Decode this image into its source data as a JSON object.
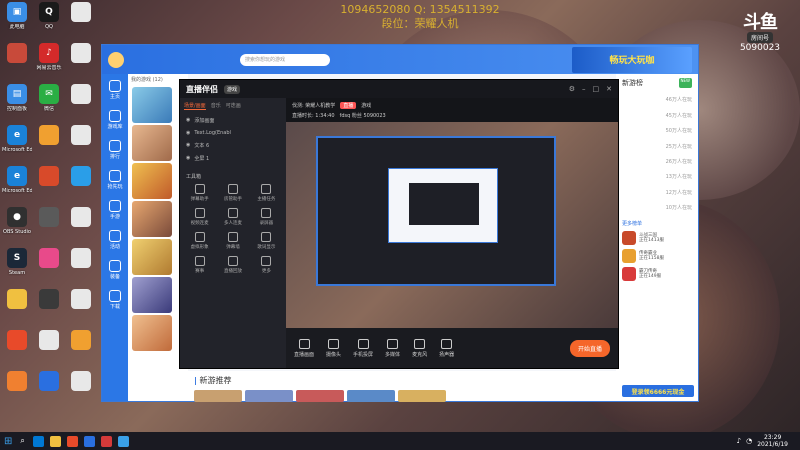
{
  "overlay": {
    "contact_line1": "1094652080  Q:  1354511392",
    "contact_line2": "段位：荣耀人机"
  },
  "room_badge": {
    "logo": "斗鱼",
    "room_label": "房间号",
    "room_id": "5090023"
  },
  "desktop_icons": [
    {
      "label": "此电脑",
      "color": "#3a8ee6",
      "glyph": "▣"
    },
    {
      "label": "QQ",
      "color": "#1a1a1a",
      "glyph": "Q"
    },
    {
      "label": "",
      "color": "#e8e8e8",
      "glyph": ""
    },
    {
      "label": "",
      "color": "#c84a3a",
      "glyph": ""
    },
    {
      "label": "网易云音乐",
      "color": "#d42a2a",
      "glyph": "♪"
    },
    {
      "label": "",
      "color": "#e8e8e8",
      "glyph": ""
    },
    {
      "label": "控制面板",
      "color": "#3a8ee6",
      "glyph": "▤"
    },
    {
      "label": "微信",
      "color": "#2aae44",
      "glyph": "✉"
    },
    {
      "label": "",
      "color": "#e8e8e8",
      "glyph": ""
    },
    {
      "label": "Microsoft Edge",
      "color": "#1a82d8",
      "glyph": "e"
    },
    {
      "label": "",
      "color": "#f0a030",
      "glyph": ""
    },
    {
      "label": "",
      "color": "#e8e8e8",
      "glyph": ""
    },
    {
      "label": "Microsoft Edge",
      "color": "#1a82d8",
      "glyph": "e"
    },
    {
      "label": "",
      "color": "#d84a2a",
      "glyph": ""
    },
    {
      "label": "",
      "color": "#2a9ee8",
      "glyph": ""
    },
    {
      "label": "OBS Studio",
      "color": "#303030",
      "glyph": "●"
    },
    {
      "label": "",
      "color": "#5a5a5a",
      "glyph": ""
    },
    {
      "label": "",
      "color": "#e8e8e8",
      "glyph": ""
    },
    {
      "label": "Steam",
      "color": "#1b2838",
      "glyph": "S"
    },
    {
      "label": "",
      "color": "#e84a8a",
      "glyph": ""
    },
    {
      "label": "",
      "color": "#e8e8e8",
      "glyph": ""
    },
    {
      "label": "",
      "color": "#f0c040",
      "glyph": ""
    },
    {
      "label": "",
      "color": "#3a3a3a",
      "glyph": ""
    },
    {
      "label": "",
      "color": "#e8e8e8",
      "glyph": ""
    },
    {
      "label": "",
      "color": "#e84a2a",
      "glyph": ""
    },
    {
      "label": "",
      "color": "#e8e8e8",
      "glyph": ""
    },
    {
      "label": "",
      "color": "#f0a030",
      "glyph": ""
    },
    {
      "label": "",
      "color": "#f08030",
      "glyph": ""
    },
    {
      "label": "",
      "color": "#2a6fe0",
      "glyph": ""
    },
    {
      "label": "",
      "color": "#e8e8e8",
      "glyph": ""
    }
  ],
  "app": {
    "search_placeholder": "搜索你想玩的游戏",
    "ad_text": "畅玩大玩咖",
    "nav": [
      {
        "label": "主页"
      },
      {
        "label": "游戏库"
      },
      {
        "label": "排行"
      },
      {
        "label": "抢先玩"
      },
      {
        "label": "手游"
      },
      {
        "label": "活动"
      },
      {
        "label": "装备"
      },
      {
        "label": "下载"
      }
    ],
    "my_games_label": "我的游戏 (12)",
    "right_title": "新游榜",
    "right_new": "NEW",
    "right_rows": [
      "46万人在玩",
      "45万人在玩",
      "50万人在玩",
      "25万人在玩",
      "26万人在玩",
      "13万人在玩",
      "12万人在玩",
      "10万人在玩"
    ],
    "right_more": "更多榜单",
    "mini_games": [
      {
        "name": "斗战三国",
        "desc": "正在1413服",
        "color": "#c84a2a"
      },
      {
        "name": "传奇霸业",
        "desc": "正在1158服",
        "color": "#e8a030"
      },
      {
        "name": "霸刀传奇",
        "desc": "正在149服",
        "color": "#d83a3a"
      }
    ],
    "coupon": "登录领6666元现金",
    "recommend_title": "新游推荐",
    "recommend_left": "口袋奇兵"
  },
  "stream": {
    "logo": "直播伴侣",
    "version_tag": "游戏",
    "tabs": [
      "场景/画面",
      "音乐",
      "可迭画"
    ],
    "sources": [
      {
        "label": "添加画面"
      },
      {
        "label": "Text.Log(Enabl"
      },
      {
        "label": "文本 6"
      },
      {
        "label": "全屏 1"
      }
    ],
    "tools_title": "工具箱",
    "tools": [
      "弹幕助手",
      "房管助手",
      "主播任务",
      "视频连麦",
      "多人连麦",
      "录屏器",
      "虚拟形象",
      "弹幕墙",
      "歌词显示",
      "赛事",
      "直播回放",
      "更多"
    ],
    "info_title": "伐测: 荣耀人机教学",
    "info_live": "直播",
    "info_category": "游戏",
    "info_meta": "直播时长: 1:34:40",
    "info_fans": "fdsq 粉丝 5090023",
    "bottom_buttons": [
      "直播画面",
      "摄像头",
      "手机投屏",
      "多媒体",
      "麦克风",
      "扬声器"
    ],
    "go_live": "开始直播",
    "foot_left": "CPU: 24%   帧率: 30",
    "foot_right": "00:00:00"
  },
  "taskbar": {
    "time": "23:29",
    "date": "2021/6/19",
    "icon_colors": [
      "#0078d4",
      "#f0c040",
      "#e84a2a",
      "#2a6fe0",
      "#d43a3a",
      "#3aa0e8"
    ]
  }
}
